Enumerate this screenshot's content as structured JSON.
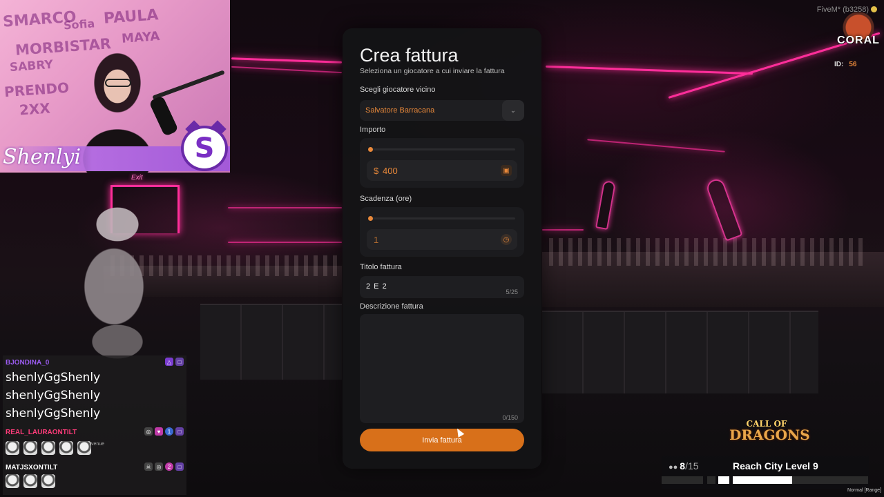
{
  "invoice": {
    "title": "Crea fattura",
    "subtitle": "Seleziona un giocatore a cui inviare la fattura",
    "player_label": "Scegli giocatore vicino",
    "player_value": "Salvatore Barracana",
    "amount_label": "Importo",
    "amount_currency": "$",
    "amount_value": "400",
    "amount_slider_fraction": 0.0,
    "due_label": "Scadenza (ore)",
    "due_value": "1",
    "due_slider_fraction": 0.0,
    "title_label": "Titolo fattura",
    "title_value": "2 E 2",
    "title_counter": "5/25",
    "description_label": "Descrizione fattura",
    "description_counter": "0/150",
    "submit_label": "Invia fattura",
    "accent_color": "#e8883a"
  },
  "server": {
    "fivem_build": "FiveM* (b3258)",
    "logo_text": "CORAL",
    "id_label": "ID:",
    "id_value": "56"
  },
  "stream": {
    "streamer_name": "Shenlyi",
    "logo_letter": "S",
    "wall_words": [
      "SMARCO",
      "Sofia",
      "PAULA",
      "MORBISTAR",
      "MAYA",
      "SABRY",
      "PRENDO",
      "2XX"
    ],
    "scene_sign": "Exit"
  },
  "chat": {
    "messages": [
      {
        "user": "BJONDINA_0",
        "user_color": "#9b5cf0",
        "lines": [
          "shenlyGgShenly",
          "shenlyGgShenly",
          "shenlyGgShenly"
        ]
      },
      {
        "user": "REAL_LAURAONTILT",
        "user_color": "#ff3c7a",
        "badge_count": "1",
        "emote_caption": "Ivenue"
      },
      {
        "user": "MATJSXONTILT",
        "user_color": "#ffffff",
        "badge_count": "2"
      }
    ]
  },
  "hud": {
    "game_logo_top": "CALL OF",
    "game_logo_bottom": "DRAGONS",
    "players_current": "8",
    "players_max": "/15",
    "quest": "Reach City Level 9",
    "mode": "Normal [Range]"
  }
}
